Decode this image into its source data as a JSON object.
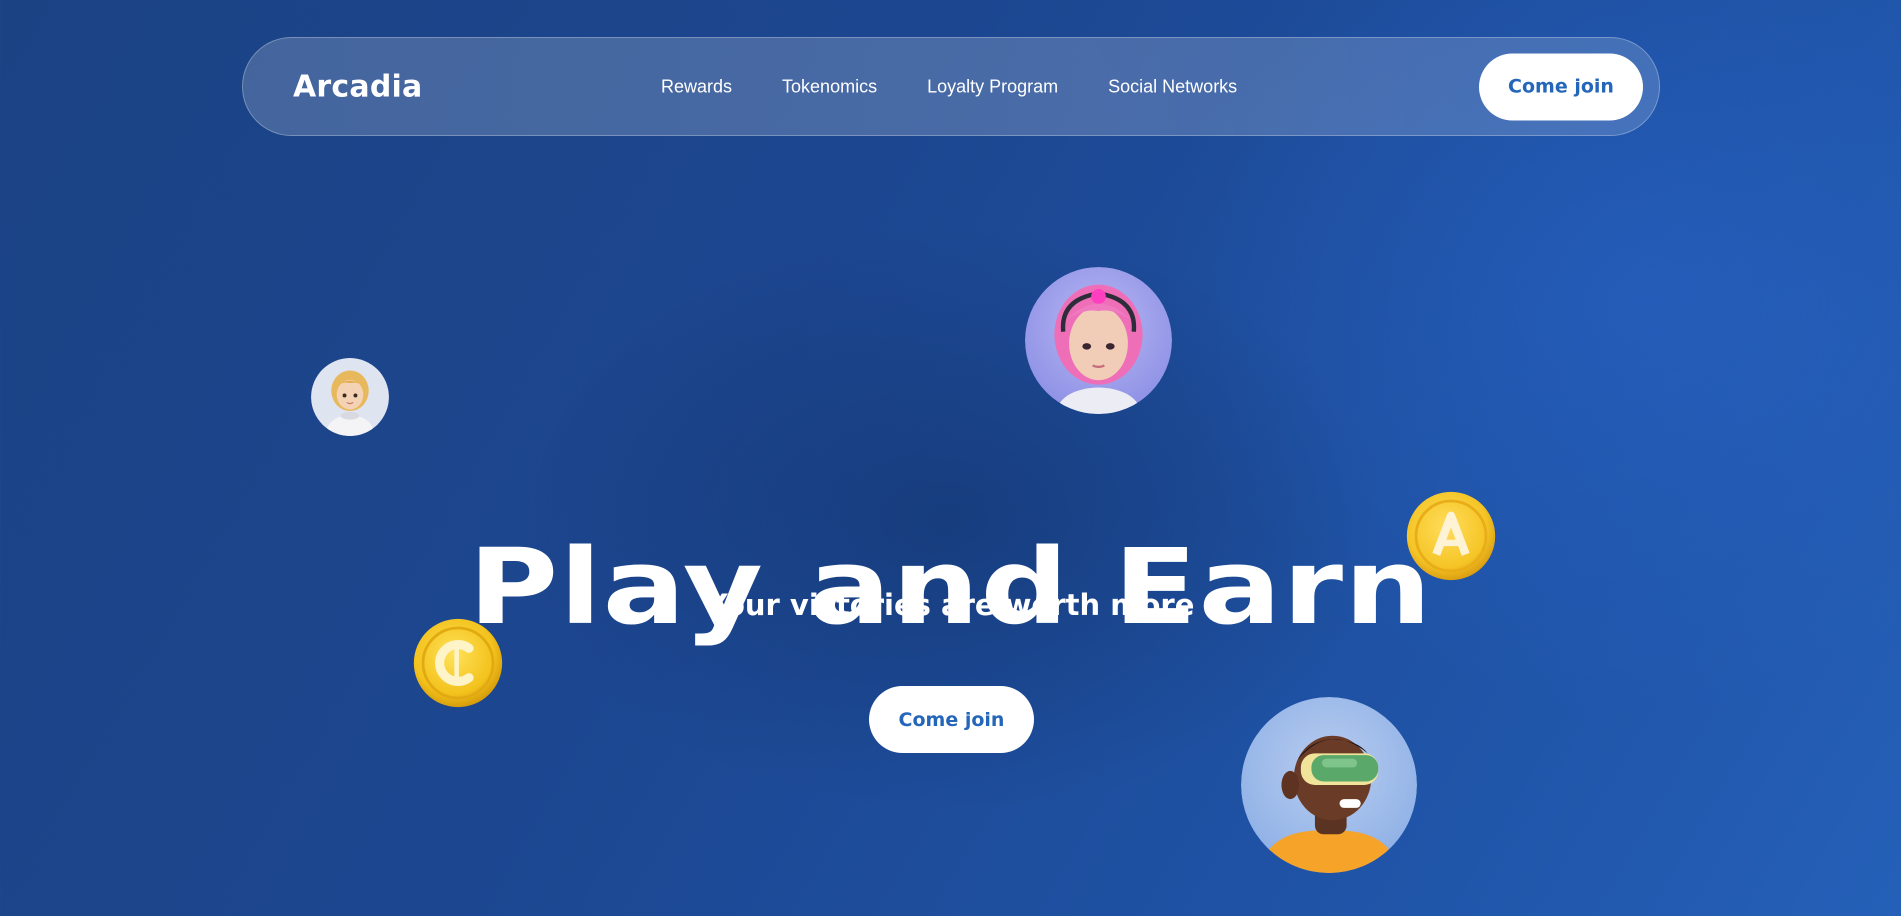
{
  "header": {
    "logo": "Arcadia",
    "nav": [
      {
        "label": "Rewards"
      },
      {
        "label": "Tokenomics"
      },
      {
        "label": "Loyalty Program"
      },
      {
        "label": "Social Networks"
      }
    ],
    "cta_label": "Come join"
  },
  "hero": {
    "title": "Play and Earn",
    "subtitle": "Your victories are worth more",
    "cta_label": "Come join"
  },
  "decorations": {
    "avatars": [
      "blonde-girl-avatar",
      "pink-hair-girl-avatar",
      "vr-headset-boy-avatar"
    ],
    "coins": [
      {
        "icon": "c-coin-icon",
        "glyph": "₵"
      },
      {
        "icon": "a-coin-icon",
        "glyph": "A"
      }
    ]
  },
  "colors": {
    "background": "#1c4690",
    "accent": "#2466b9",
    "button_bg": "#ffffff",
    "coin_gold": "#f5c526"
  }
}
